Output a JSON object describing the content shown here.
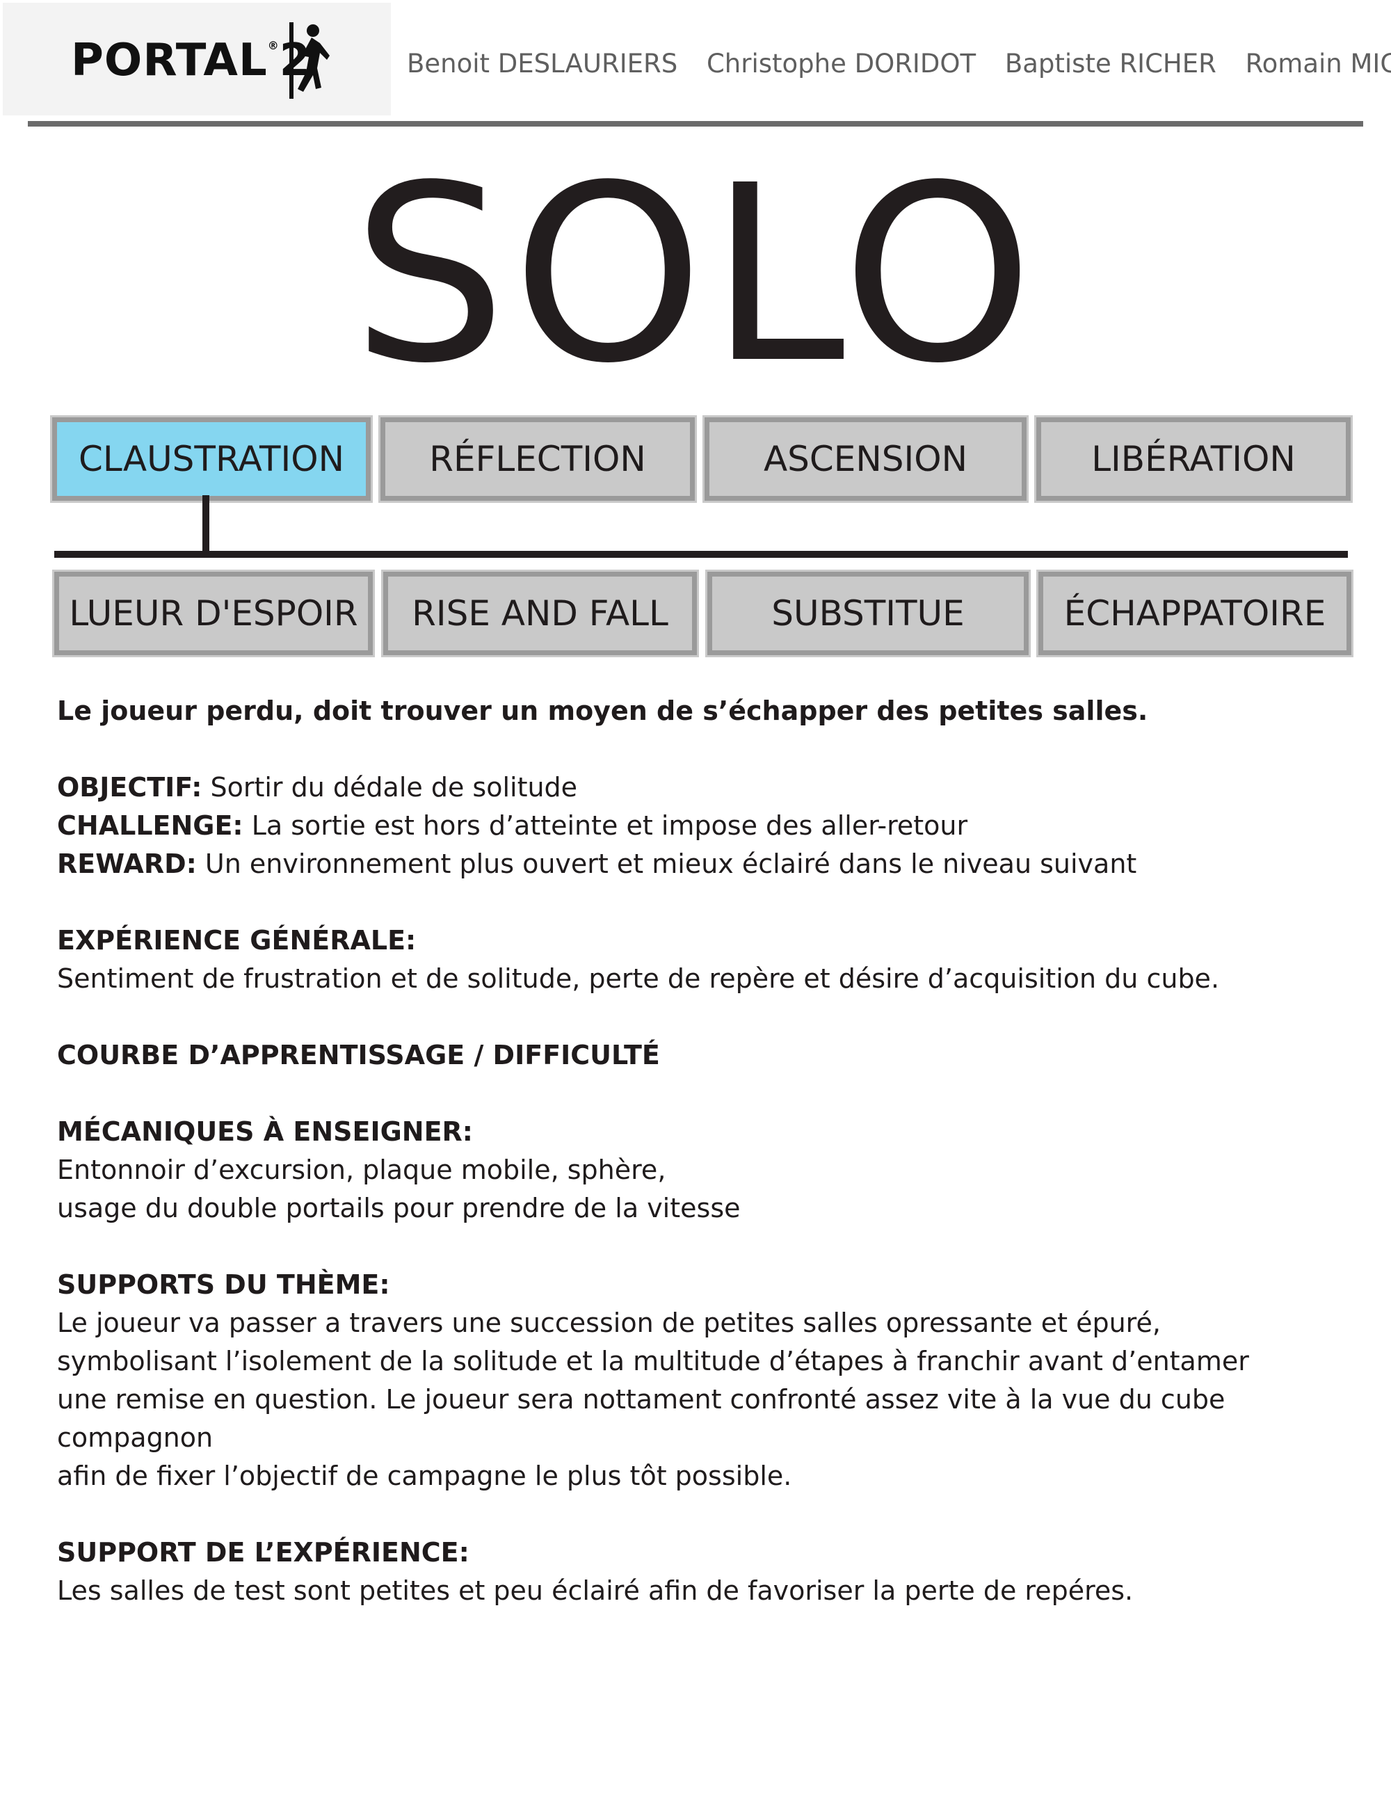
{
  "header": {
    "logo_text": "PORTAL",
    "logo_number": "2",
    "logo_registered": "®",
    "authors": [
      "Benoit DESLAURIERS",
      "Christophe DORIDOT",
      "Baptiste RICHER",
      "Romain MIGLIO"
    ]
  },
  "title": "SOLO",
  "chapters_top": [
    "CLAUSTRATION",
    "RÉFLECTION",
    "ASCENSION",
    "LIBÉRATION"
  ],
  "chapters_bottom": [
    "LUEUR D'ESPOIR",
    "RISE AND FALL",
    "SUBSTITUE",
    "ÉCHAPPATOIRE"
  ],
  "active_chapter": "CLAUSTRATION",
  "colors": {
    "active": "#85d6f0",
    "tab": "#c9c9c9",
    "tab_border": "#9a9a9a",
    "text": "#1f1b1c"
  },
  "content": {
    "intro": "Le joueur perdu, doit trouver un moyen de s’échapper des petites salles.",
    "objectif_label": "OBJECTIF:",
    "objectif_text": " Sortir du dédale de solitude",
    "challenge_label": "CHALLENGE:",
    "challenge_text": " La sortie est hors d’atteinte et impose des aller-retour",
    "reward_label": "REWARD:",
    "reward_text": " Un environnement plus ouvert et mieux éclairé dans le niveau suivant",
    "experience_label": "EXPÉRIENCE GÉNÉRALE:",
    "experience_text": "Sentiment de frustration et de solitude, perte de repère et désire d’acquisition du cube.",
    "courbe_label": "COURBE D’APPRENTISSAGE / DIFFICULTÉ",
    "mecaniques_label": "MÉCANIQUES À ENSEIGNER:",
    "mecaniques_lines": [
      "Entonnoir d’excursion, plaque mobile, sphère,",
      "usage du double portails pour prendre de la vitesse"
    ],
    "supports_label": "SUPPORTS DU THÈME:",
    "supports_lines": [
      "Le joueur va passer a travers une succession de petites salles opressante et épuré,",
      "symbolisant l’isolement de la solitude et la multitude d’étapes à franchir avant d’entamer",
      "une remise en question. Le joueur sera nottament confronté assez vite à la vue du cube compagnon",
      "afin de fixer l’objectif de campagne le plus tôt possible."
    ],
    "support_exp_label": "SUPPORT DE L’EXPÉRIENCE:",
    "support_exp_text": "Les salles de test sont petites et peu éclairé afin de favoriser la perte de repéres."
  }
}
